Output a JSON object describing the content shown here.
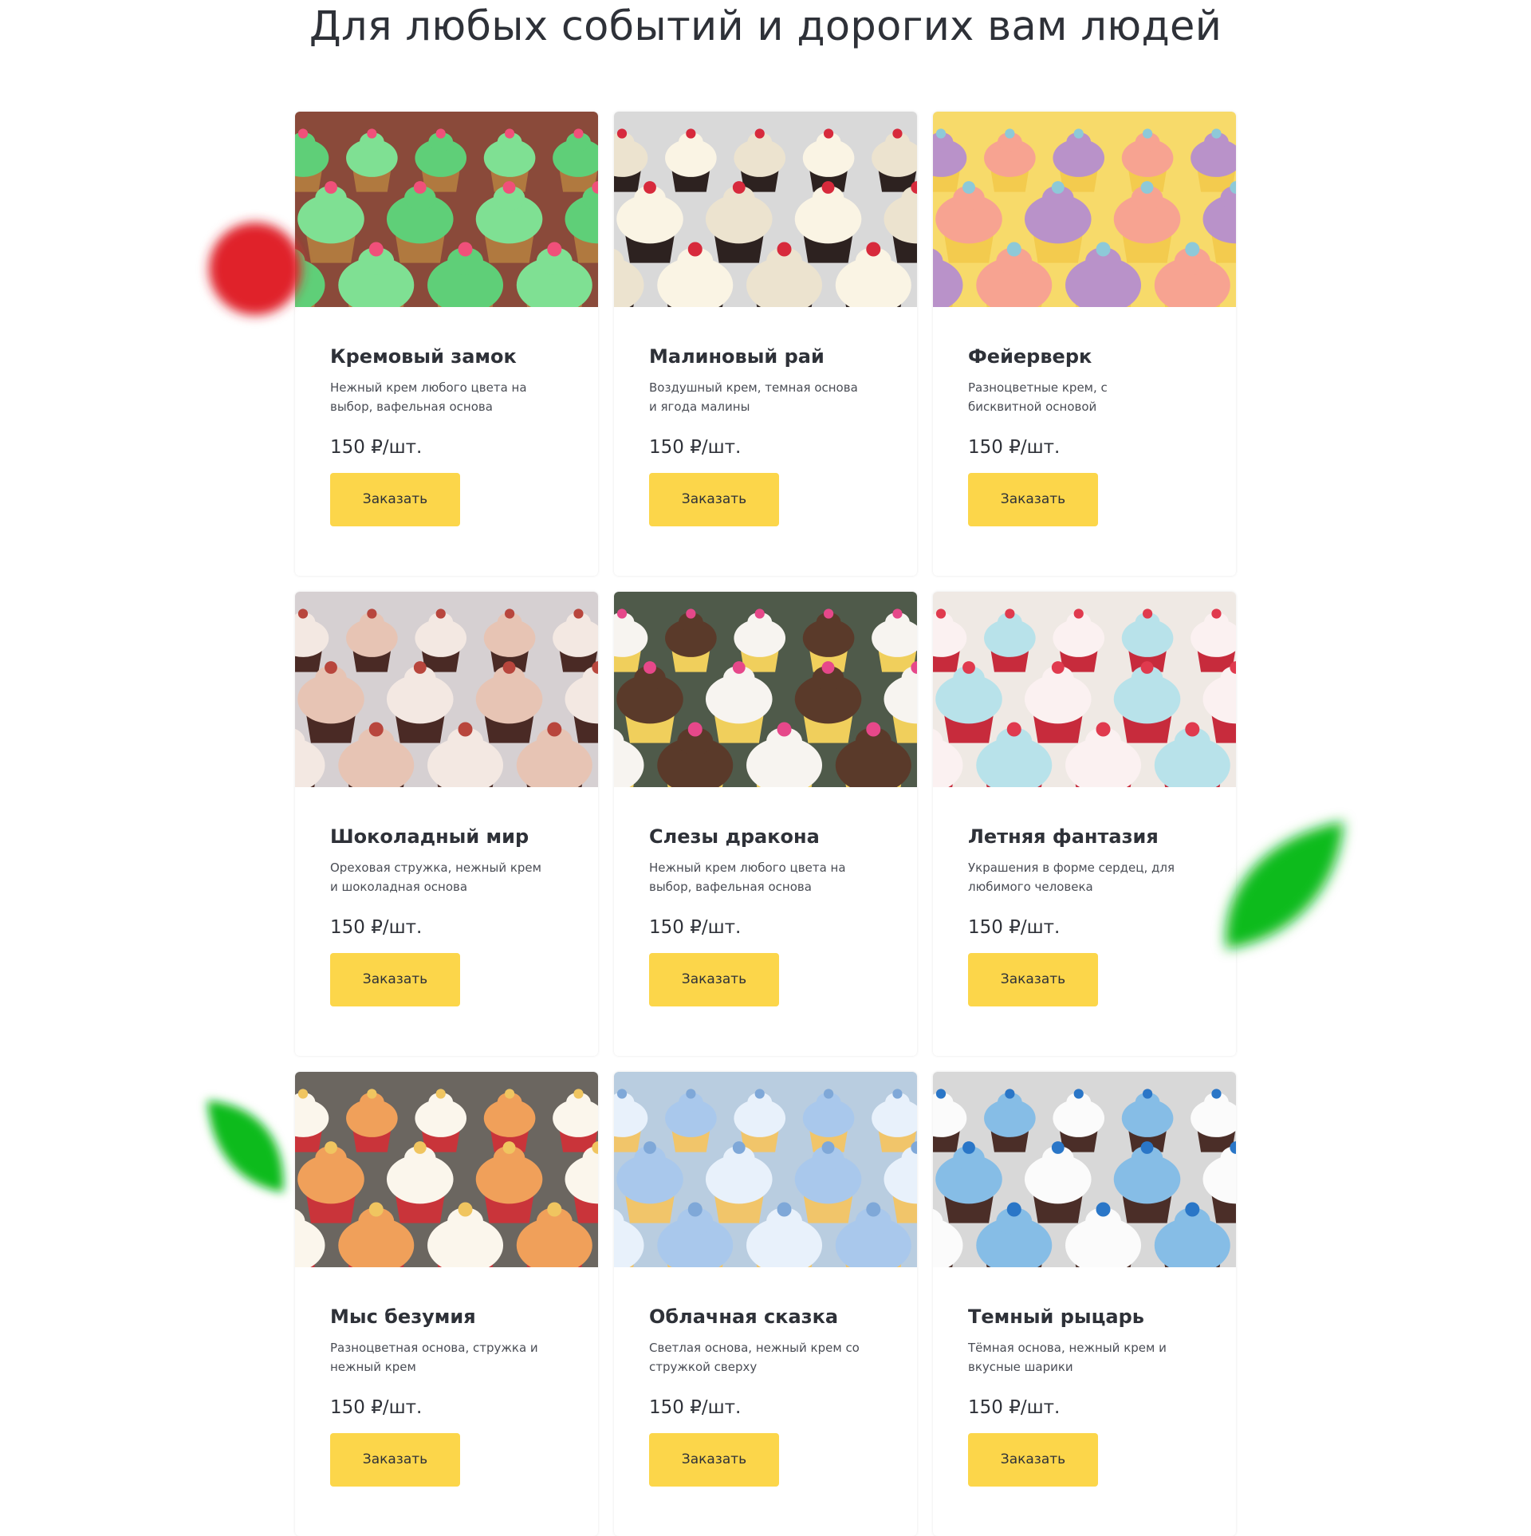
{
  "section": {
    "title": "Для любых событий и дорогих вам людей"
  },
  "products": [
    {
      "title": "Кремовый замок",
      "desc": "Нежный крем любого цвета на выбор, вафельная основа",
      "price": "150 ₽/шт.",
      "button": "Заказать",
      "image": {
        "frosting": "#5fcf78",
        "frosting_accent": "#7fe093",
        "cake": "#b0793f",
        "bg": "#8a4a3a",
        "accent": "#f0507a"
      }
    },
    {
      "title": "Малиновый рай",
      "desc": "Воздушный крем, темная основа и ягода малины",
      "price": "150 ₽/шт.",
      "button": "Заказать",
      "image": {
        "frosting": "#ece3cf",
        "frosting_accent": "#faf4e4",
        "cake": "#2d2220",
        "bg": "#d9d9d9",
        "accent": "#d72a3c"
      }
    },
    {
      "title": "Фейерверк",
      "desc": "Разноцветные крем, с бисквитной основой",
      "price": "150 ₽/шт.",
      "button": "Заказать",
      "image": {
        "frosting": "#b992c9",
        "frosting_accent": "#f7a391",
        "cake": "#f3cb4e",
        "bg": "#f7da6a",
        "accent": "#8ec9d8"
      }
    },
    {
      "title": "Шоколадный мир",
      "desc": "Ореховая стружка, нежный крем и шоколадная основа",
      "price": "150 ₽/шт.",
      "button": "Заказать",
      "image": {
        "frosting": "#f3e8e2",
        "frosting_accent": "#e7c4b4",
        "cake": "#4a2a25",
        "bg": "#d6d0d2",
        "accent": "#b8463d"
      }
    },
    {
      "title": "Слезы дракона",
      "desc": "Нежный крем любого цвета на выбор, вафельная основа",
      "price": "150 ₽/шт.",
      "button": "Заказать",
      "image": {
        "frosting": "#f7f4f0",
        "frosting_accent": "#5a3a2a",
        "cake": "#f0cf5c",
        "bg": "#4f5a4a",
        "accent": "#e6488a"
      }
    },
    {
      "title": "Летняя фантазия",
      "desc": "Украшения в форме сердец, для любимого человека",
      "price": "150 ₽/шт.",
      "button": "Заказать",
      "image": {
        "frosting": "#fbf1f1",
        "frosting_accent": "#b8e2ea",
        "cake": "#c72b3c",
        "bg": "#efe9e4",
        "accent": "#e03a4e"
      }
    },
    {
      "title": "Мыс безумия",
      "desc": "Разноцветная основа, стружка и нежный крем",
      "price": "150 ₽/шт.",
      "button": "Заказать",
      "image": {
        "frosting": "#fbf6ec",
        "frosting_accent": "#f0a05a",
        "cake": "#c9343a",
        "bg": "#6b6660",
        "accent": "#f0c560"
      }
    },
    {
      "title": "Облачная сказка",
      "desc": "Светлая основа, нежный крем со стружкой сверху",
      "price": "150 ₽/шт.",
      "button": "Заказать",
      "image": {
        "frosting": "#e8f1fb",
        "frosting_accent": "#a9c8ec",
        "cake": "#f1c56a",
        "bg": "#b9cde0",
        "accent": "#7fa8d8"
      }
    },
    {
      "title": "Темный рыцарь",
      "desc": "Тёмная основа, нежный крем и вкусные шарики",
      "price": "150 ₽/шт.",
      "button": "Заказать",
      "image": {
        "frosting": "#fbfbfb",
        "frosting_accent": "#86bde6",
        "cake": "#4b2e28",
        "bg": "#d8d8d8",
        "accent": "#2a76c7"
      }
    }
  ],
  "decorations": {
    "raspberry_color": "#e0242a",
    "leaf_color": "#0fbb1f"
  }
}
